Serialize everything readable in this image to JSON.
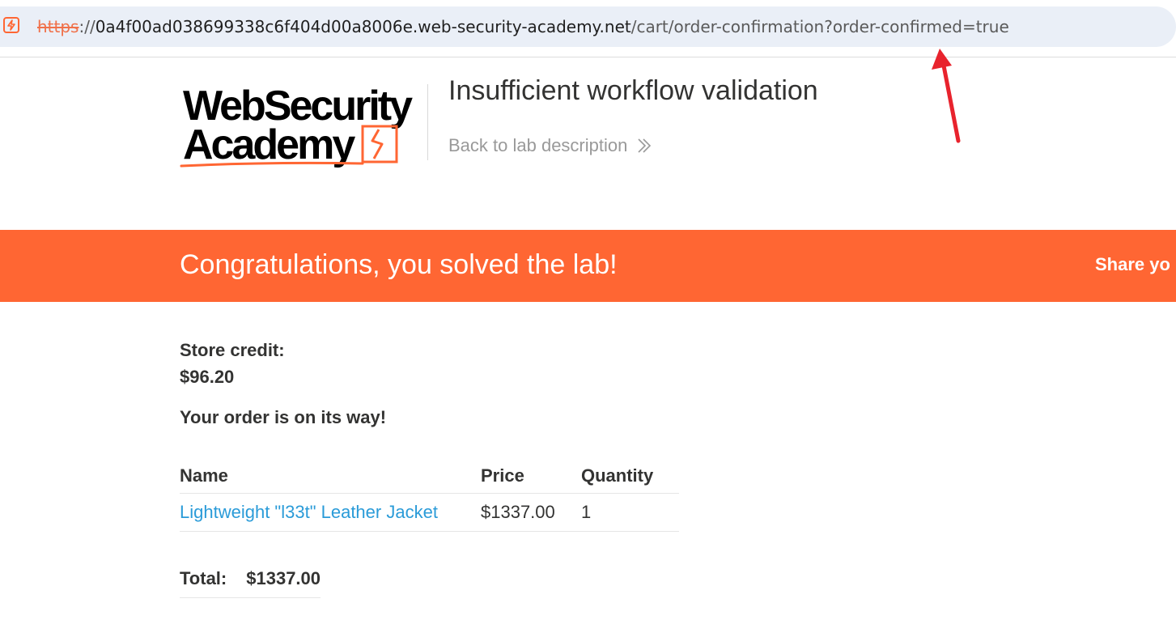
{
  "browser": {
    "url_scheme": "https",
    "url_separator": "://",
    "url_domain": "0a4f00ad038699338c6f404d00a8006e.web-security-academy.net",
    "url_path": "/cart/order-confirmation?order-confirmed=true",
    "site_icon": "lightning-bolt-icon"
  },
  "header": {
    "logo_line1": "WebSecurity",
    "logo_line2": "Academy",
    "lab_title": "Insufficient workflow validation",
    "back_link_label": "Back to lab description",
    "back_icon": "double-chevron-right-icon"
  },
  "banner": {
    "message": "Congratulations, you solved the lab!",
    "share_label": "Share yo"
  },
  "account": {
    "credit_label": "Store credit:",
    "credit_value": "$96.20",
    "order_message": "Your order is on its way!"
  },
  "order_table": {
    "headers": {
      "name": "Name",
      "price": "Price",
      "quantity": "Quantity"
    },
    "rows": [
      {
        "name": "Lightweight \"l33t\" Leather Jacket",
        "price": "$1337.00",
        "quantity": "1"
      }
    ]
  },
  "totals": {
    "label": "Total:",
    "value": "$1337.00"
  },
  "colors": {
    "brand_orange": "#ff6633",
    "link_blue": "#2a9bd8",
    "annotation_red": "#e8232d",
    "address_bar_bg": "#eaeff7"
  }
}
